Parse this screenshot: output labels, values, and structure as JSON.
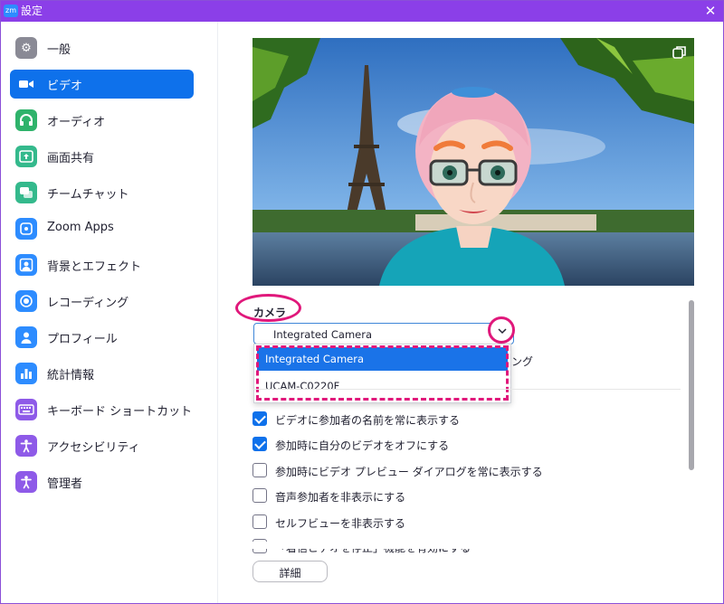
{
  "window": {
    "app_icon": "zm",
    "title": "設定",
    "close_symbol": "✕"
  },
  "sidebar": {
    "items": [
      {
        "label": "一般",
        "icon": "gear-icon",
        "color": "#7d7d8a",
        "glyph": "⚙",
        "active": false
      },
      {
        "label": "ビデオ",
        "icon": "video-camera-icon",
        "color": "#0e71eb",
        "glyph": "■",
        "active": true
      },
      {
        "label": "オーディオ",
        "icon": "headphones-icon",
        "color": "#27ae60",
        "glyph": "♫",
        "active": false
      },
      {
        "label": "画面共有",
        "icon": "share-screen-icon",
        "color": "#2fb88b",
        "glyph": "↑",
        "active": false
      },
      {
        "label": "チームチャット",
        "icon": "chat-icon",
        "color": "#2fb88b",
        "glyph": "✉",
        "active": false
      },
      {
        "label": "Zoom Apps",
        "icon": "apps-icon",
        "color": "#2d8cff",
        "glyph": "◎",
        "active": false
      },
      {
        "label": "背景とエフェクト",
        "icon": "background-icon",
        "color": "#2d8cff",
        "glyph": "▣",
        "active": false
      },
      {
        "label": "レコーディング",
        "icon": "record-icon",
        "color": "#2d8cff",
        "glyph": "◉",
        "active": false
      },
      {
        "label": "プロフィール",
        "icon": "profile-icon",
        "color": "#2d8cff",
        "glyph": "●",
        "active": false
      },
      {
        "label": "統計情報",
        "icon": "statistics-icon",
        "color": "#2d8cff",
        "glyph": "▮",
        "active": false
      },
      {
        "label": "キーボード ショートカット",
        "icon": "keyboard-icon",
        "color": "#8e5ae8",
        "glyph": "⌨",
        "active": false
      },
      {
        "label": "アクセシビリティ",
        "icon": "accessibility-icon",
        "color": "#8e5ae8",
        "glyph": "♿",
        "active": false
      },
      {
        "label": "管理者",
        "icon": "admin-icon",
        "color": "#8e5ae8",
        "glyph": "♟",
        "active": false
      }
    ]
  },
  "camera": {
    "label": "カメラ",
    "selected": "Integrated Camera",
    "options": [
      "Integrated Camera",
      "UCAM-C0220F"
    ],
    "hidden_text_tail": "ング",
    "highlight_color": "#e0187b"
  },
  "checkboxes": [
    {
      "label": "ビデオに参加者の名前を常に表示する",
      "checked": true
    },
    {
      "label": "参加時に自分のビデオをオフにする",
      "checked": true
    },
    {
      "label": "参加時にビデオ プレビュー ダイアログを常に表示する",
      "checked": false
    },
    {
      "label": "音声参加者を非表示にする",
      "checked": false
    },
    {
      "label": "セルフビューを非表示する",
      "checked": false
    },
    {
      "label": "「着信ビデオを停止」機能を有効にする",
      "checked": false
    }
  ],
  "details_button": "詳細",
  "colors": {
    "titlebar": "#8b3fe8",
    "accent": "#0e71eb",
    "annotation": "#e0187b"
  }
}
